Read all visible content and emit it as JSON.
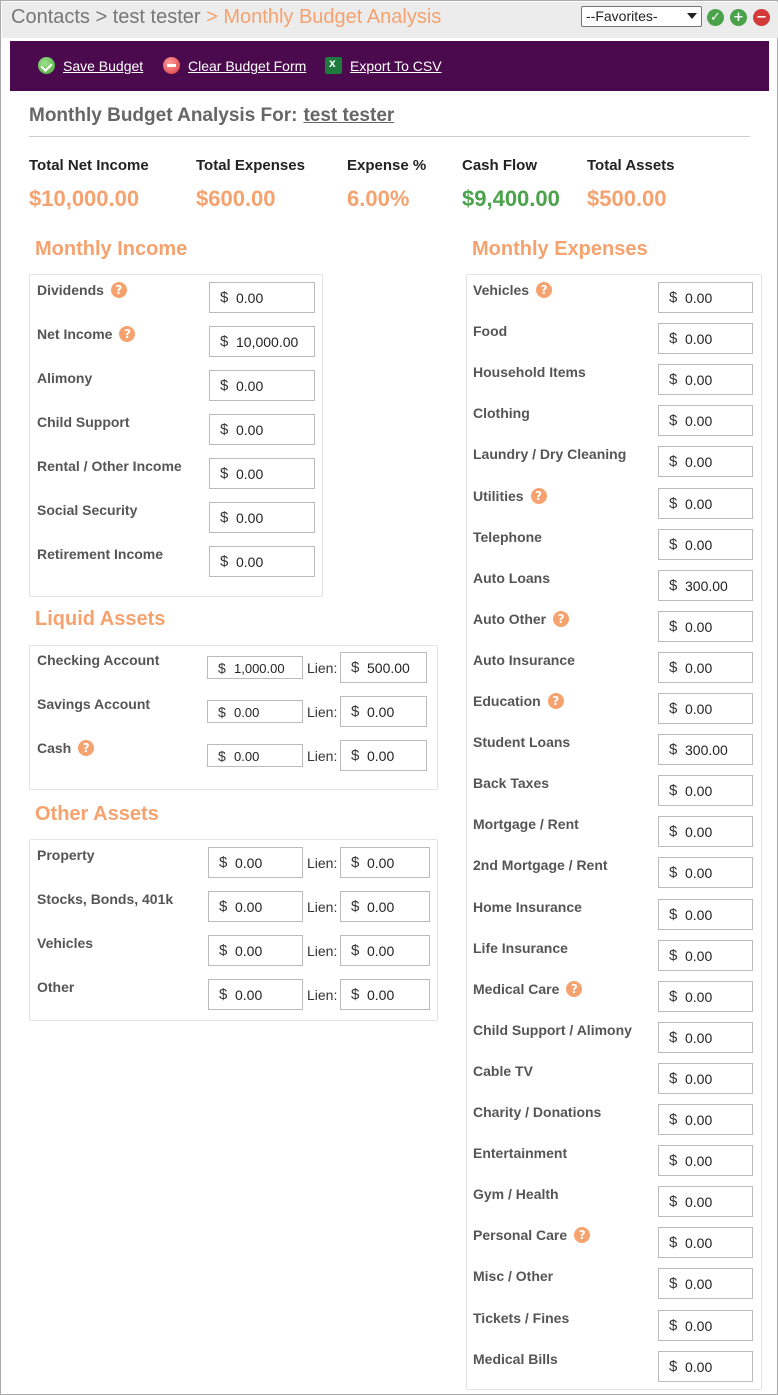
{
  "breadcrumb": {
    "root": "Contacts",
    "sep1": ">",
    "contact": "test tester",
    "current": "> Monthly Budget Analysis"
  },
  "favorites": {
    "selected": "--Favorites-"
  },
  "toolbar": {
    "save_label": "Save Budget",
    "clear_label": "Clear Budget Form",
    "export_label": "Export To CSV"
  },
  "heading": {
    "prefix": "Monthly Budget Analysis For:",
    "name": "test tester"
  },
  "summary": [
    {
      "label": "Total Net Income",
      "value": "$10,000.00",
      "color": "#f5a26f"
    },
    {
      "label": "Total Expenses",
      "value": "$600.00",
      "color": "#f5a26f"
    },
    {
      "label": "Expense %",
      "value": "6.00%",
      "color": "#f5a26f"
    },
    {
      "label": "Cash Flow",
      "value": "$9,400.00",
      "color": "#4aa24a"
    },
    {
      "label": "Total Assets",
      "value": "$500.00",
      "color": "#f5a26f"
    }
  ],
  "currency_symbol": "$",
  "lien_label": "Lien:",
  "income": {
    "title": "Monthly Income",
    "rows": [
      {
        "label": "Dividends",
        "help": true,
        "value": "0.00"
      },
      {
        "label": "Net Income",
        "help": true,
        "value": "10,000.00"
      },
      {
        "label": "Alimony",
        "help": false,
        "value": "0.00"
      },
      {
        "label": "Child Support",
        "help": false,
        "value": "0.00"
      },
      {
        "label": "Rental / Other Income",
        "help": false,
        "value": "0.00"
      },
      {
        "label": "Social Security",
        "help": false,
        "value": "0.00"
      },
      {
        "label": "Retirement Income",
        "help": false,
        "value": "0.00"
      }
    ]
  },
  "liquid": {
    "title": "Liquid Assets",
    "rows": [
      {
        "label": "Checking Account",
        "help": false,
        "value": "1,000.00",
        "lien": "500.00"
      },
      {
        "label": "Savings Account",
        "help": false,
        "value": "0.00",
        "lien": "0.00"
      },
      {
        "label": "Cash",
        "help": true,
        "value": "0.00",
        "lien": "0.00"
      }
    ]
  },
  "other": {
    "title": "Other Assets",
    "rows": [
      {
        "label": "Property",
        "help": false,
        "value": "0.00",
        "lien": "0.00"
      },
      {
        "label": "Stocks, Bonds, 401k",
        "help": false,
        "value": "0.00",
        "lien": "0.00"
      },
      {
        "label": "Vehicles",
        "help": false,
        "value": "0.00",
        "lien": "0.00"
      },
      {
        "label": "Other",
        "help": false,
        "value": "0.00",
        "lien": "0.00"
      }
    ]
  },
  "expenses": {
    "title": "Monthly Expenses",
    "rows": [
      {
        "label": "Vehicles",
        "help": true,
        "value": "0.00"
      },
      {
        "label": "Food",
        "help": false,
        "value": "0.00"
      },
      {
        "label": "Household Items",
        "help": false,
        "value": "0.00"
      },
      {
        "label": "Clothing",
        "help": false,
        "value": "0.00"
      },
      {
        "label": "Laundry / Dry Cleaning",
        "help": false,
        "value": "0.00"
      },
      {
        "label": "Utilities",
        "help": true,
        "value": "0.00"
      },
      {
        "label": "Telephone",
        "help": false,
        "value": "0.00"
      },
      {
        "label": "Auto Loans",
        "help": false,
        "value": "300.00"
      },
      {
        "label": "Auto Other",
        "help": true,
        "value": "0.00"
      },
      {
        "label": "Auto Insurance",
        "help": false,
        "value": "0.00"
      },
      {
        "label": "Education",
        "help": true,
        "value": "0.00"
      },
      {
        "label": "Student Loans",
        "help": false,
        "value": "300.00"
      },
      {
        "label": "Back Taxes",
        "help": false,
        "value": "0.00"
      },
      {
        "label": "Mortgage / Rent",
        "help": false,
        "value": "0.00"
      },
      {
        "label": "2nd Mortgage / Rent",
        "help": false,
        "value": "0.00"
      },
      {
        "label": "Home Insurance",
        "help": false,
        "value": "0.00"
      },
      {
        "label": "Life Insurance",
        "help": false,
        "value": "0.00"
      },
      {
        "label": "Medical Care",
        "help": true,
        "value": "0.00"
      },
      {
        "label": "Child Support / Alimony",
        "help": false,
        "value": "0.00"
      },
      {
        "label": "Cable TV",
        "help": false,
        "value": "0.00"
      },
      {
        "label": "Charity / Donations",
        "help": false,
        "value": "0.00"
      },
      {
        "label": "Entertainment",
        "help": false,
        "value": "0.00"
      },
      {
        "label": "Gym / Health",
        "help": false,
        "value": "0.00"
      },
      {
        "label": "Personal Care",
        "help": true,
        "value": "0.00"
      },
      {
        "label": "Misc / Other",
        "help": false,
        "value": "0.00"
      },
      {
        "label": "Tickets / Fines",
        "help": false,
        "value": "0.00"
      },
      {
        "label": "Medical Bills",
        "help": false,
        "value": "0.00"
      }
    ]
  }
}
